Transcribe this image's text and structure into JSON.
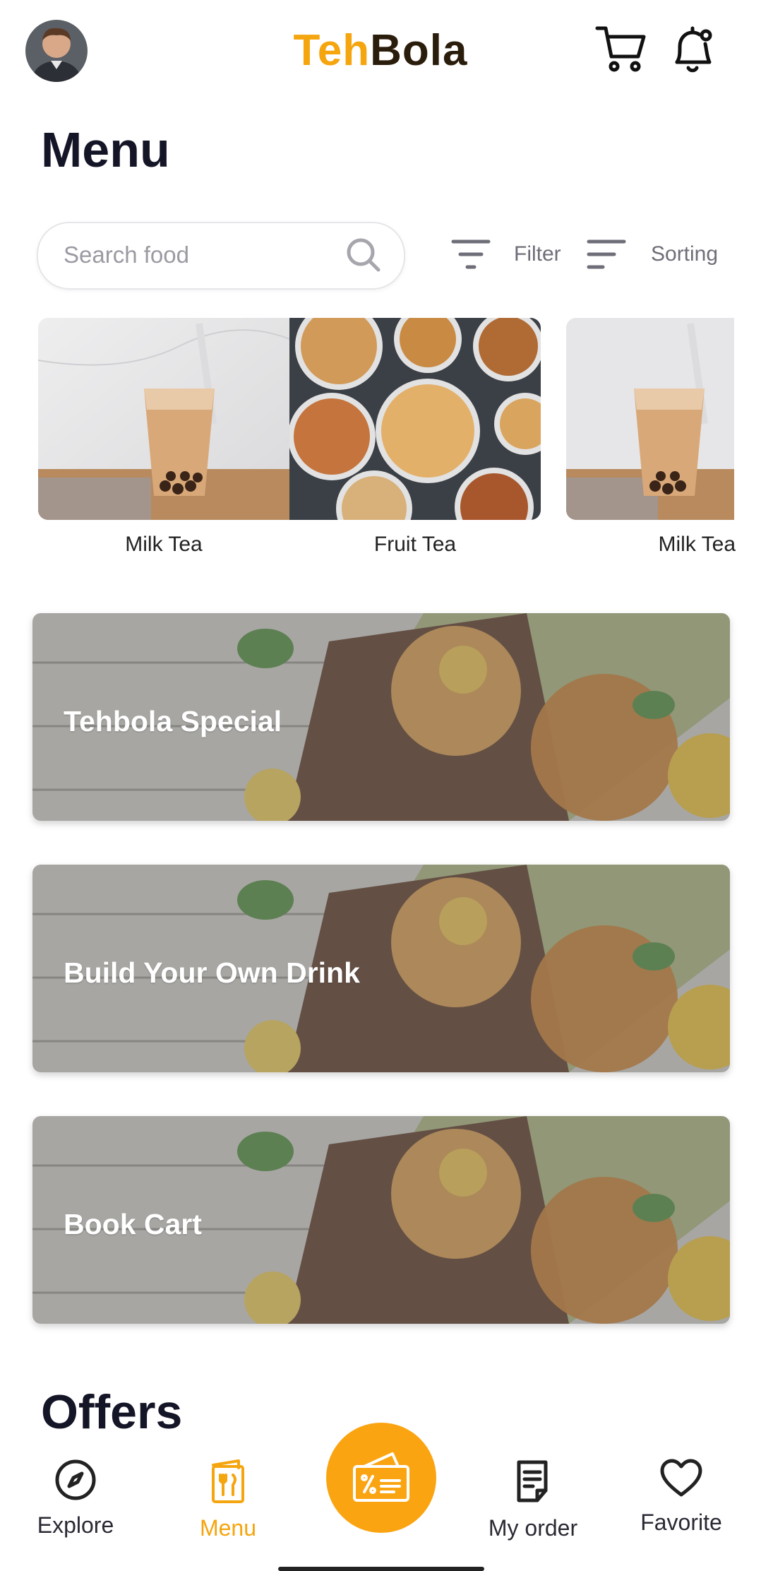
{
  "header": {
    "logo_part1": "Teh",
    "logo_part2": "Bola",
    "avatar_icon": "user-avatar",
    "cart_icon": "cart-icon",
    "bell_icon": "bell-icon"
  },
  "page_title": "Menu",
  "search": {
    "placeholder": "Search food",
    "filter_label": "Filter",
    "sorting_label": "Sorting"
  },
  "categories": [
    {
      "label": "Milk Tea",
      "image": "milk-tea-image"
    },
    {
      "label": "Fruit Tea",
      "image": "snack-bowls-image"
    },
    {
      "label": "Milk Tea",
      "image": "milk-tea-image"
    }
  ],
  "banners": [
    {
      "title": "Tehbola Special"
    },
    {
      "title": "Build Your Own Drink"
    },
    {
      "title": "Book Cart"
    }
  ],
  "offers_title": "Offers",
  "nav": {
    "items": [
      {
        "label": "Explore",
        "icon": "compass-icon",
        "active": false
      },
      {
        "label": "Menu",
        "icon": "menu-book-icon",
        "active": true
      },
      {
        "label": "My order",
        "icon": "order-list-icon",
        "active": false
      },
      {
        "label": "Favorite",
        "icon": "heart-icon",
        "active": false
      }
    ],
    "center_icon": "voucher-card-icon"
  },
  "colors": {
    "accent": "#f5a50e",
    "fab": "#fba411",
    "text_dark": "#151528"
  }
}
